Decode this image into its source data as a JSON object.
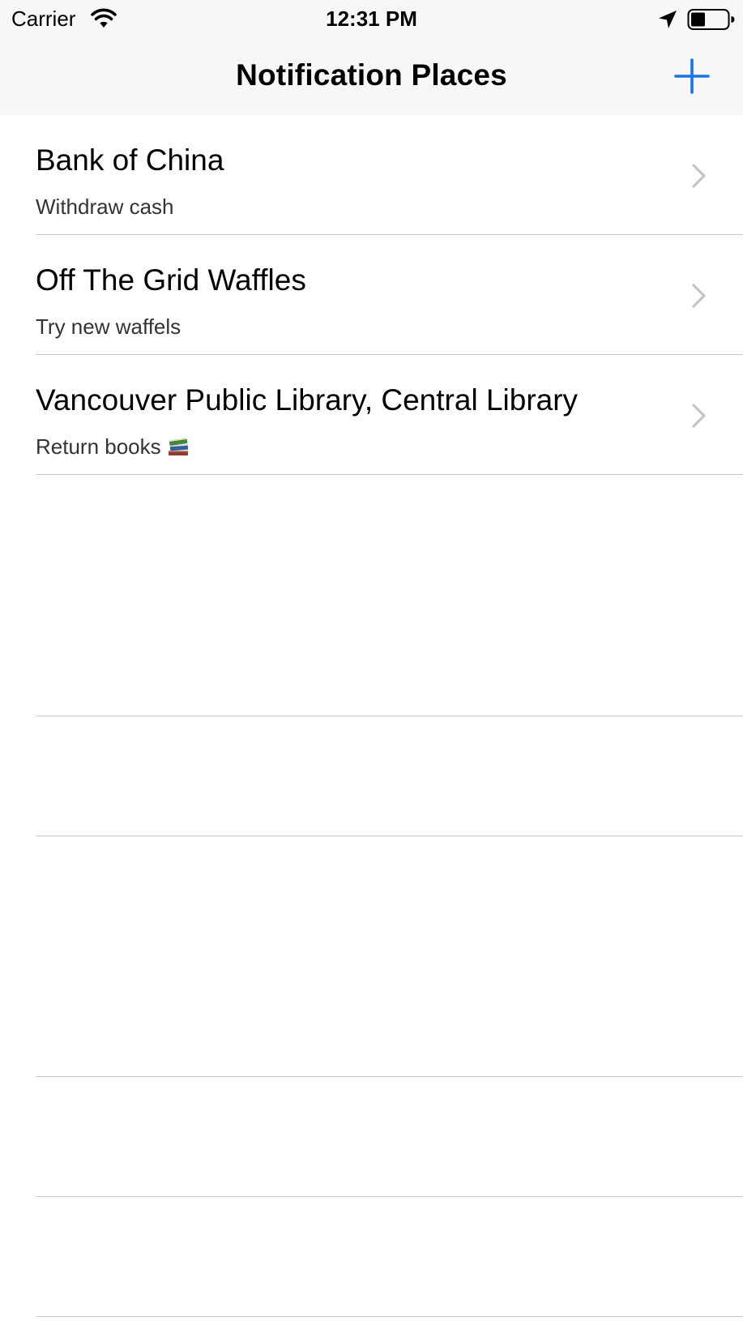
{
  "status_bar": {
    "carrier": "Carrier",
    "time": "12:31 PM",
    "icons": [
      "wifi-icon",
      "location-arrow-icon",
      "battery-icon"
    ],
    "battery_level": 0.4
  },
  "nav_bar": {
    "title": "Notification Places",
    "add_icon": "plus-icon"
  },
  "places": [
    {
      "name": "Bank of China",
      "note": "Withdraw cash",
      "emoji": ""
    },
    {
      "name": "Off The Grid Waffles",
      "note": "Try new waffels",
      "emoji": ""
    },
    {
      "name": "Vancouver Public Library, Central Library",
      "note": "Return books",
      "emoji": "books-icon"
    }
  ],
  "colors": {
    "accent": "#1a73e8",
    "separator": "#c8c7cc",
    "bar_background": "#f7f7f7",
    "chevron": "#c4c4c9"
  }
}
